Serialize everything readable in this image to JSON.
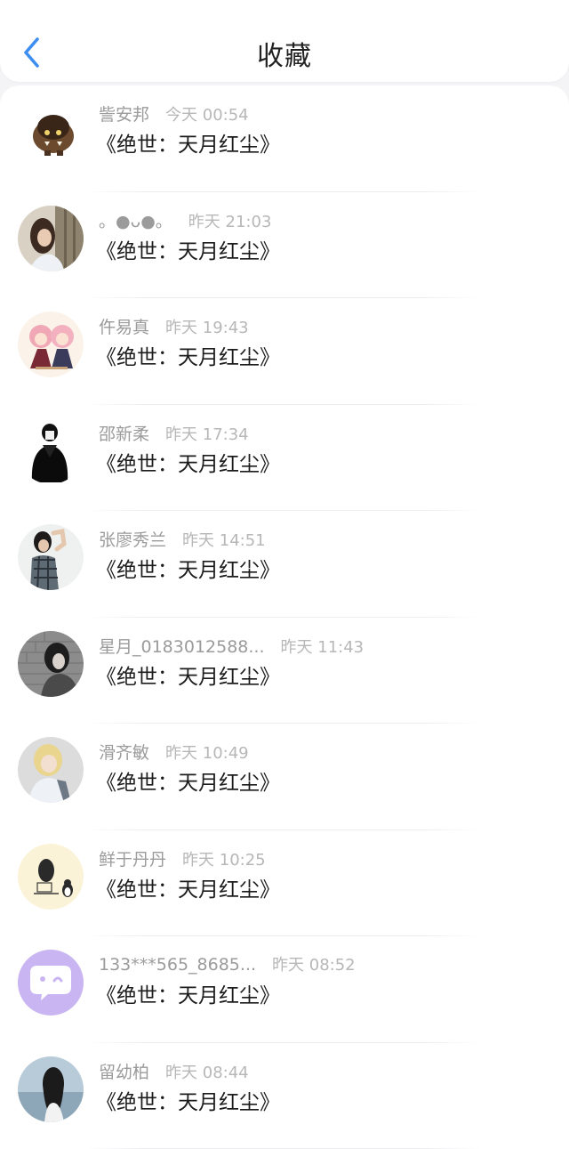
{
  "header": {
    "title": "收藏",
    "back_icon": "chevron-left-icon",
    "accent_color": "#3d8ef0"
  },
  "items": [
    {
      "username": "訾安邦",
      "time": "今天 00:54",
      "title": "《绝世：天月红尘》",
      "avatar": "avatar-orc-icon"
    },
    {
      "username": "。●ᴗ●。",
      "time": "昨天 21:03",
      "title": "《绝世：天月红尘》",
      "avatar": "avatar-girl-window-icon"
    },
    {
      "username": "仵易真",
      "time": "昨天 19:43",
      "title": "《绝世：天月红尘》",
      "avatar": "avatar-anime-girls-icon"
    },
    {
      "username": "邵新柔",
      "time": "昨天 17:34",
      "title": "《绝世：天月红尘》",
      "avatar": "avatar-hoodie-icon"
    },
    {
      "username": "张廖秀兰",
      "time": "昨天 14:51",
      "title": "《绝世：天月红尘》",
      "avatar": "avatar-plaid-shirt-icon"
    },
    {
      "username": "星月_0183012588...",
      "time": "昨天 11:43",
      "title": "《绝世：天月红尘》",
      "avatar": "avatar-girl-wall-icon"
    },
    {
      "username": "滑齐敏",
      "time": "昨天 10:49",
      "title": "《绝世：天月红尘》",
      "avatar": "avatar-blonde-girl-icon"
    },
    {
      "username": "鲜于丹丹",
      "time": "昨天 10:25",
      "title": "《绝世：天月红尘》",
      "avatar": "avatar-sketch-penguin-icon"
    },
    {
      "username": "133***565_8685...",
      "time": "昨天 08:52",
      "title": "《绝世：天月红尘》",
      "avatar": "avatar-chat-bubble-icon"
    },
    {
      "username": "留幼柏",
      "time": "昨天 08:44",
      "title": "《绝世：天月红尘》",
      "avatar": "avatar-girl-beach-icon"
    }
  ]
}
